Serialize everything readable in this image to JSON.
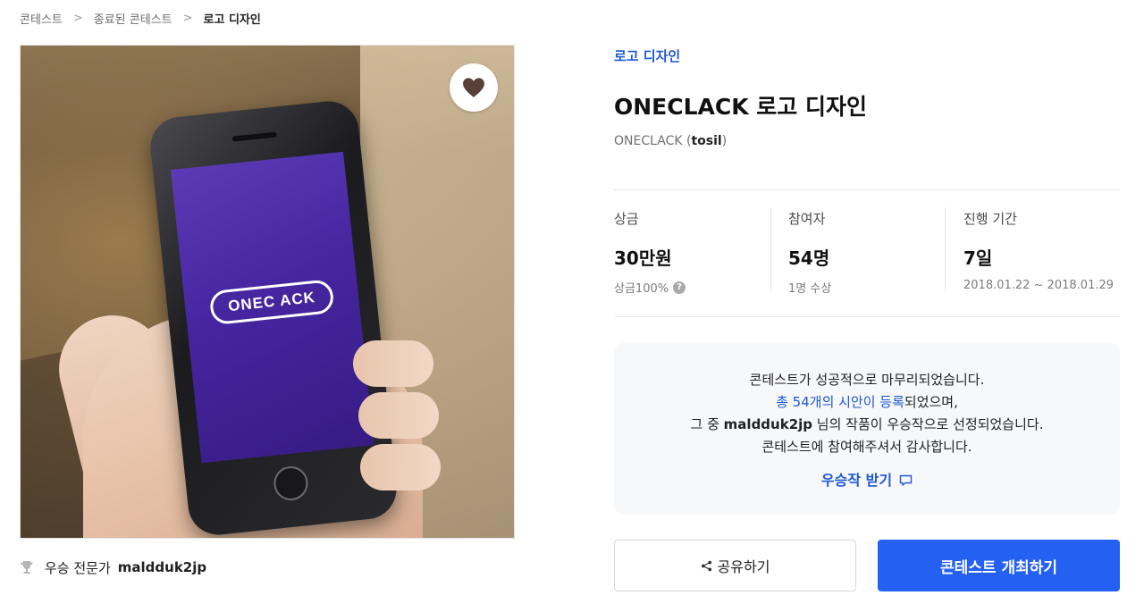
{
  "breadcrumb": [
    "콘테스트",
    "종료된 콘테스트",
    "로고 디자인"
  ],
  "hero": {
    "logo_text": "ONEC ACK",
    "colors": {
      "screen": "#4a2aa8"
    }
  },
  "winner": {
    "label": "우승 전문가",
    "name": "maldduk2jp"
  },
  "contest": {
    "category": "로고 디자인",
    "title": "ONECLACK 로고 디자인",
    "host_name": "ONECLACK",
    "host_id": "tosil"
  },
  "stats": [
    {
      "label": "상금",
      "value": "30만원",
      "sub": "상금100%"
    },
    {
      "label": "참여자",
      "value": "54명",
      "sub": "1명 수상"
    },
    {
      "label": "진행 기간",
      "value": "7일",
      "sub": "2018.01.22 ~ 2018.01.29"
    }
  ],
  "notice": {
    "line1": "콘테스트가 성공적으로 마무리되었습니다.",
    "line2_link": "총 54개의 시안이 등록",
    "line2_rest": "되었으며,",
    "line3_pre": "그 중 ",
    "line3_name": "maldduk2jp",
    "line3_post": " 님의 작품이 우승작으로 선정되었습니다.",
    "line4": "콘테스트에 참여해주셔서 감사합니다.",
    "cta": "우승작 받기"
  },
  "actions": {
    "share": "공유하기",
    "host": "콘테스트 개최하기"
  },
  "colors": {
    "accent": "#2460f2",
    "link": "#1e58d6"
  }
}
